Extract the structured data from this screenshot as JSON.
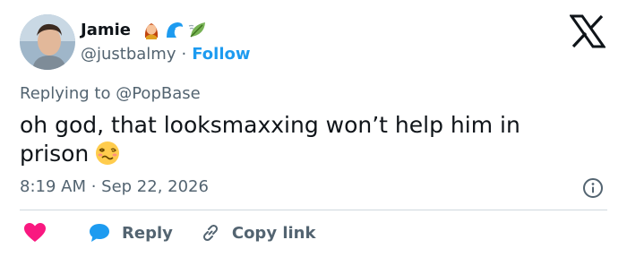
{
  "user": {
    "display_name": "Jamie",
    "handle": "@justbalmy",
    "follow_label": "Follow",
    "separator": "·",
    "name_emojis": [
      "woman-red-hair-emoji",
      "wave-emoji",
      "leaf-emoji"
    ]
  },
  "reply_context": {
    "prefix": "Replying to",
    "mention": "@PopBase"
  },
  "tweet": {
    "text": "oh god, that looksmaxxing won’t help him in prison",
    "trailing_emoji": "woozy-face-emoji",
    "timestamp": "8:19 AM · Sep 22, 2026"
  },
  "actions": {
    "like_icon": "heart-icon",
    "reply_label": "Reply",
    "copy_label": "Copy link"
  },
  "colors": {
    "accent": "#1d9bf0",
    "heart": "#f91880",
    "secondary_text": "#536471",
    "primary_text": "#0f1419",
    "divider": "#cfd9de"
  }
}
